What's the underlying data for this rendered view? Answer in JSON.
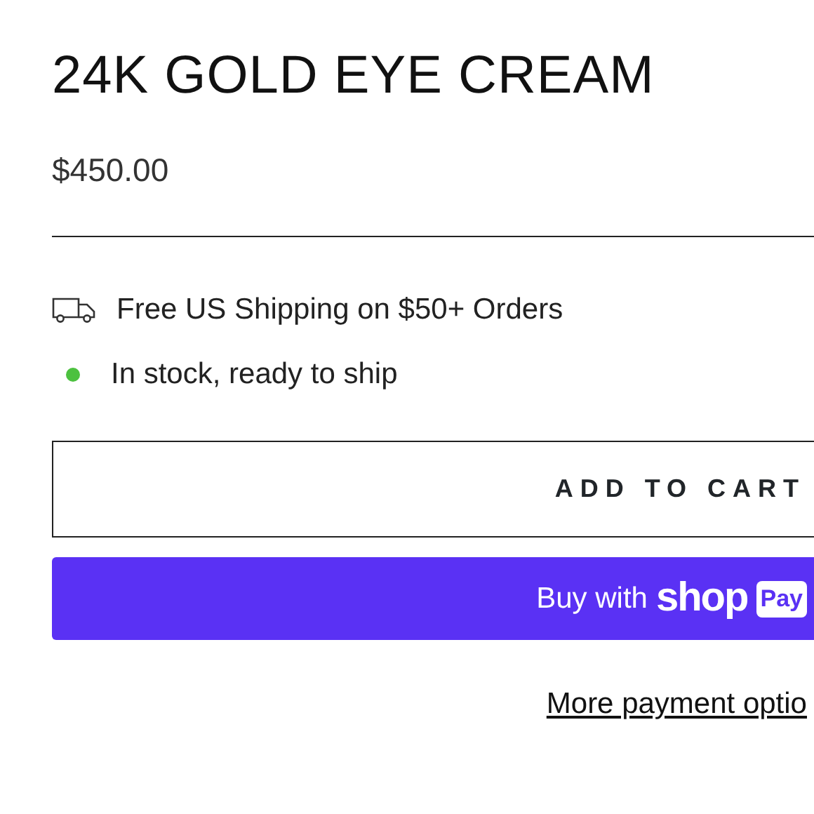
{
  "product": {
    "title": "24K GOLD EYE CREAM",
    "price": "$450.00"
  },
  "notes": [
    {
      "kind": "shipping",
      "text": "Free US Shipping on $50+ Orders"
    },
    {
      "kind": "stock",
      "text": "In stock, ready to ship",
      "color": "#4cc13f"
    }
  ],
  "add_to_cart": "ADD TO CART",
  "shop_pay": {
    "prefix": "Buy with",
    "brand": "shop",
    "badge": "Pay"
  },
  "more_payment": "More payment optio"
}
